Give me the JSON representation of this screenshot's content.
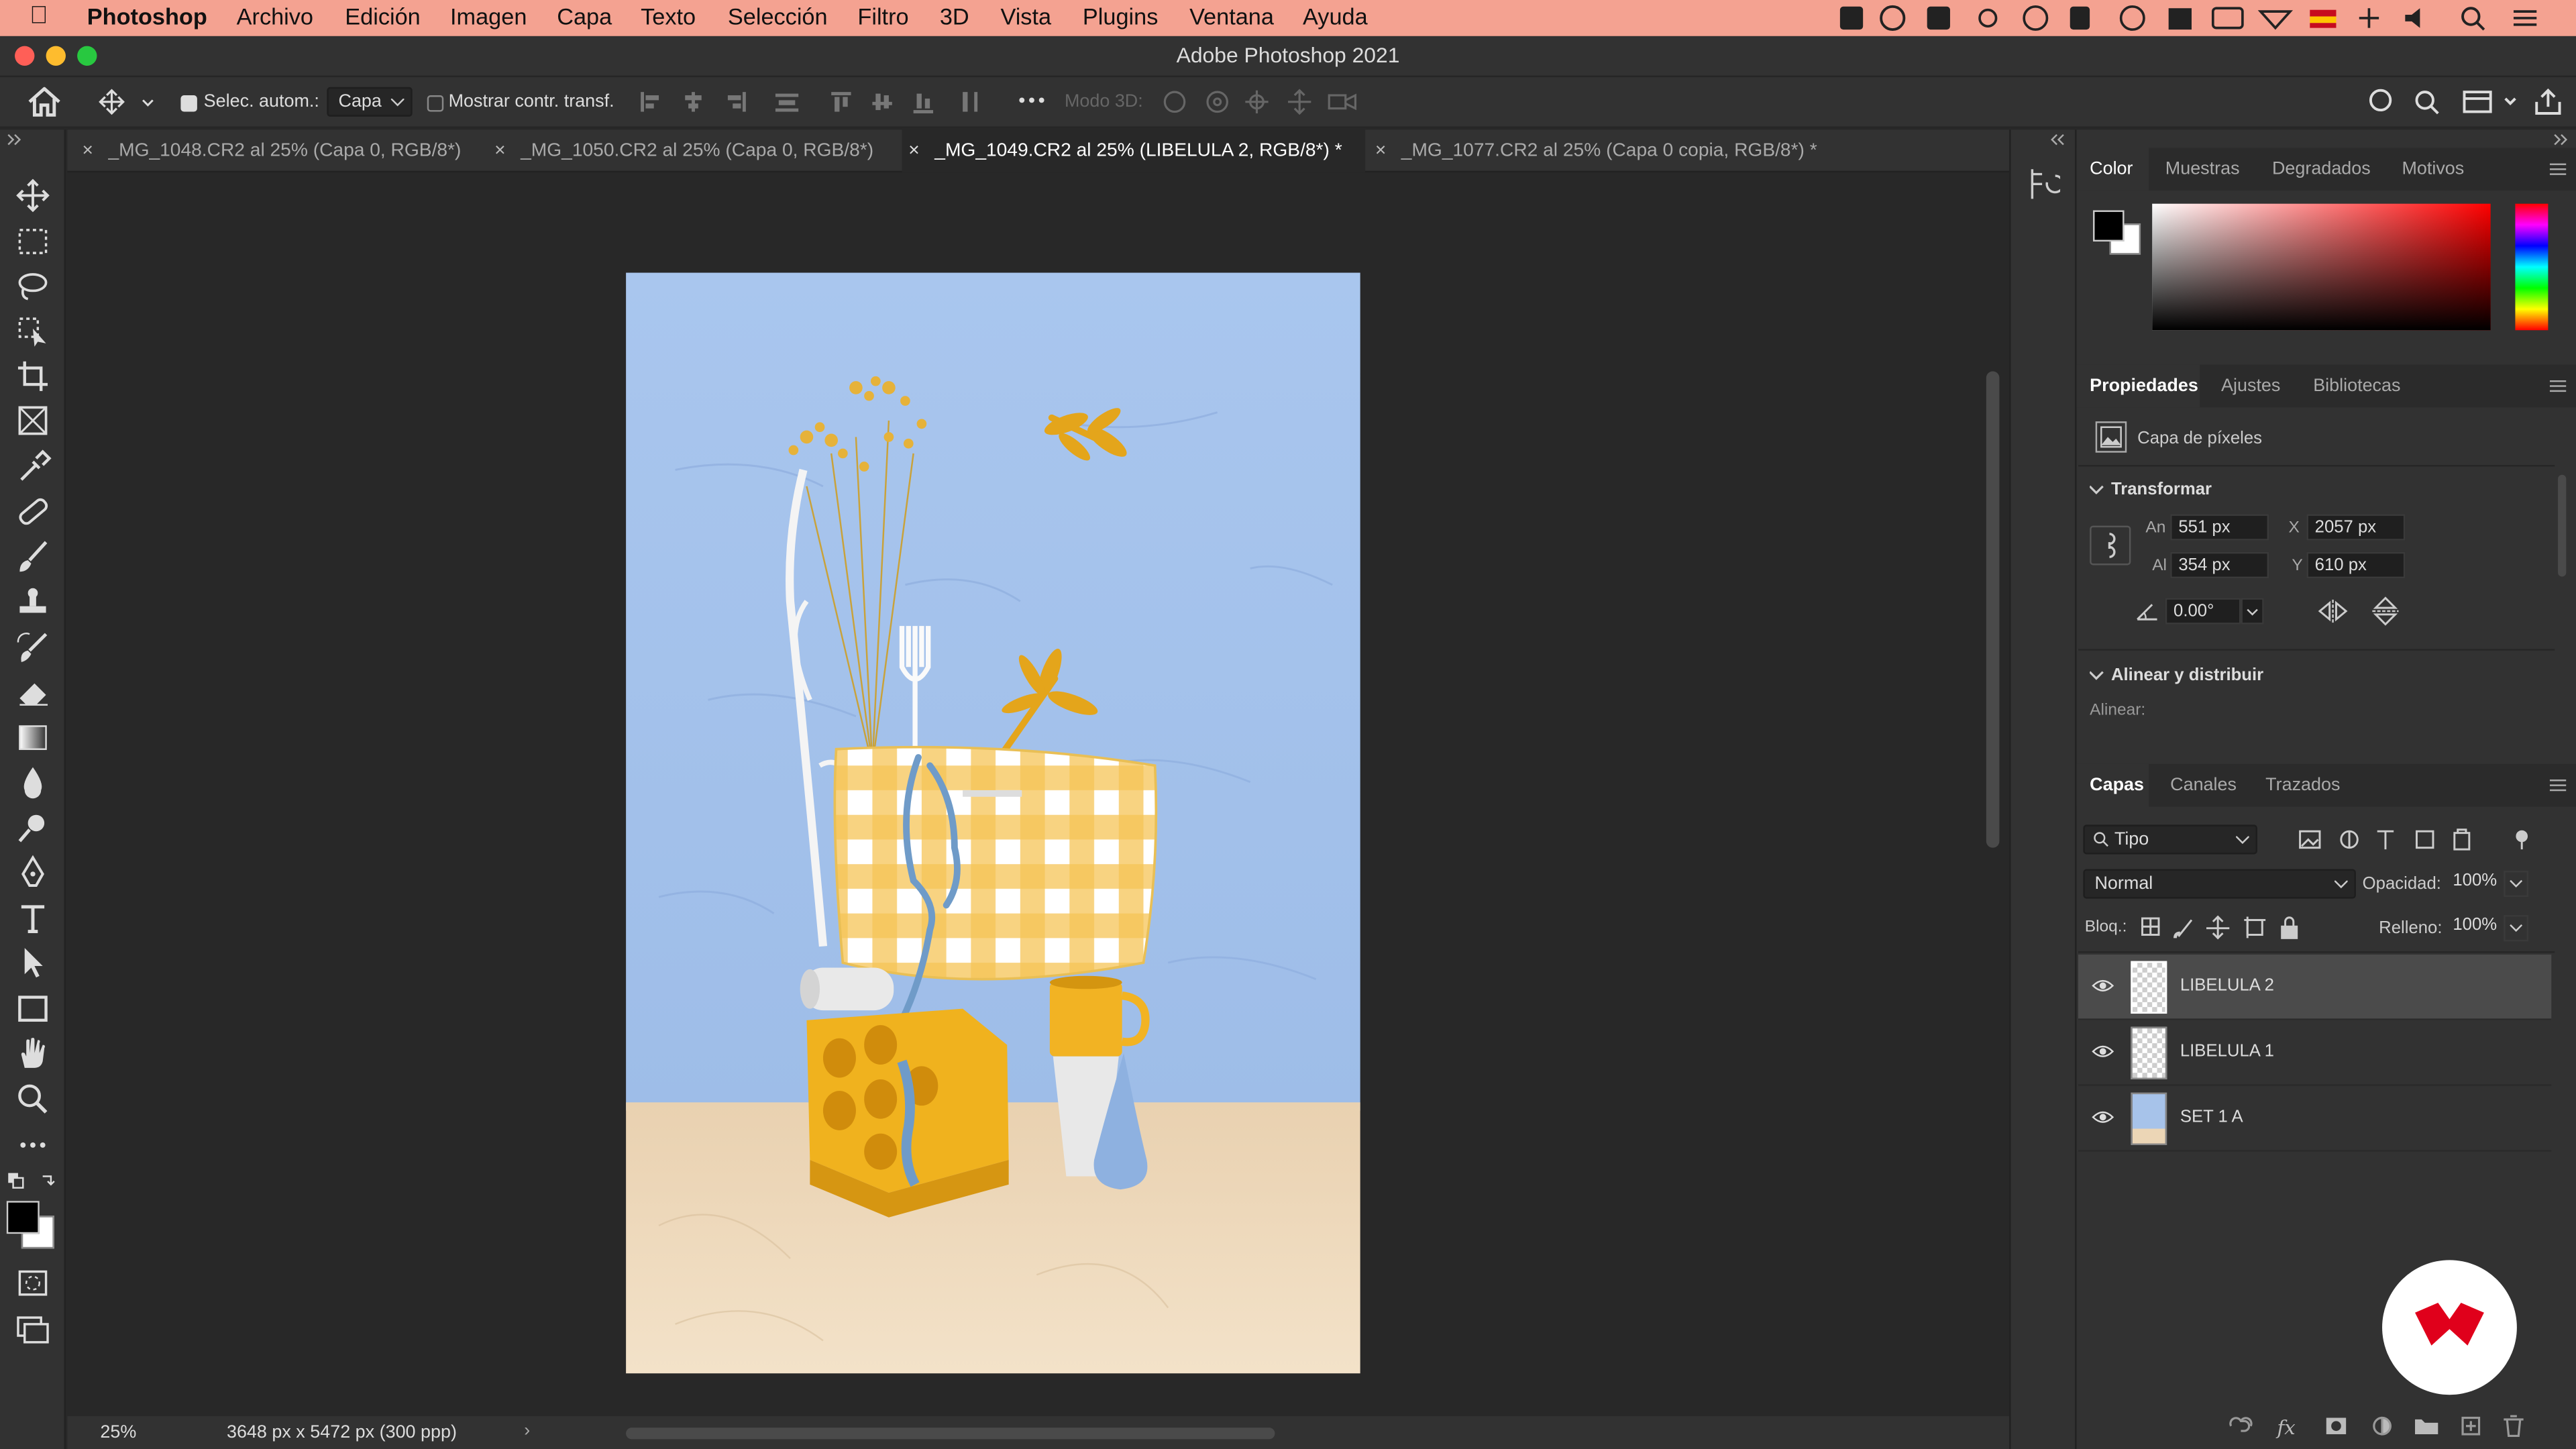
{
  "menubar": {
    "app_name": "Photoshop",
    "items": [
      "Archivo",
      "Edición",
      "Imagen",
      "Capa",
      "Texto",
      "Selección",
      "Filtro",
      "3D",
      "Vista",
      "Plugins",
      "Ventana",
      "Ayuda"
    ]
  },
  "window": {
    "title": "Adobe Photoshop 2021"
  },
  "options": {
    "auto_select_label": "Selec. autom.:",
    "auto_select_value": "Capa",
    "show_transform_label": "Mostrar contr. transf.",
    "mode_3d_label": "Modo 3D:"
  },
  "tabs": [
    {
      "label": "_MG_1048.CR2 al 25% (Capa 0, RGB/8*)"
    },
    {
      "label": "_MG_1050.CR2 al 25% (Capa 0, RGB/8*)"
    },
    {
      "label": "_MG_1049.CR2 al 25% (LIBELULA 2, RGB/8*) *",
      "active": true
    },
    {
      "label": "_MG_1077.CR2 al 25% (Capa 0 copia, RGB/8*) *"
    }
  ],
  "status": {
    "zoom": "25%",
    "doc_info": "3648 px x 5472 px (300 ppp)"
  },
  "color_panel": {
    "tabs": [
      "Color",
      "Muestras",
      "Degradados",
      "Motivos"
    ],
    "foreground": "#000000",
    "background": "#ffffff",
    "hue": "#ff0000"
  },
  "properties": {
    "tabs": [
      "Propiedades",
      "Ajustes",
      "Bibliotecas"
    ],
    "layer_type": "Capa de píxeles",
    "transform_title": "Transformar",
    "width_label": "An",
    "width": "551 px",
    "height_label": "Al",
    "height": "354 px",
    "x_label": "X",
    "x": "2057 px",
    "y_label": "Y",
    "y": "610 px",
    "angle": "0.00°",
    "align_title": "Alinear y distribuir",
    "align_label": "Alinear:"
  },
  "layers_panel": {
    "tabs": [
      "Capas",
      "Canales",
      "Trazados"
    ],
    "filter_value": "Tipo",
    "blend_mode": "Normal",
    "opacity_label": "Opacidad:",
    "opacity": "100%",
    "lock_label": "Bloq.:",
    "fill_label": "Relleno:",
    "fill": "100%",
    "layers": [
      {
        "name": "LIBELULA 2",
        "selected": true
      },
      {
        "name": "LIBELULA 1",
        "selected": false
      },
      {
        "name": "SET 1 A",
        "selected": false
      }
    ]
  },
  "colors": {
    "accent_red": "#e0001b",
    "menubar_bg": "#f4a291",
    "sky_blue": "#a7c3ea",
    "mustard": "#f1b521",
    "floor": "#ecd6b6"
  }
}
